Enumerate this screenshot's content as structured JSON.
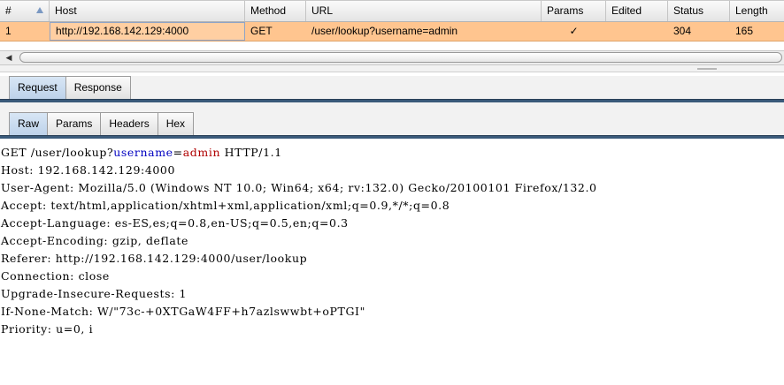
{
  "history_table": {
    "columns": [
      "#",
      "Host",
      "Method",
      "URL",
      "Params",
      "Edited",
      "Status",
      "Length"
    ],
    "rows": [
      {
        "num": "1",
        "host": "http://192.168.142.129:4000",
        "method": "GET",
        "url": "/user/lookup?username=admin",
        "params": "✓",
        "edited": "",
        "status": "304",
        "length": "165"
      }
    ],
    "row_color": "#ffc58f"
  },
  "message_tabs": [
    "Request",
    "Response"
  ],
  "request_view_tabs": [
    "Raw",
    "Params",
    "Headers",
    "Hex"
  ],
  "raw_request": {
    "request_line": {
      "prefix": "GET /user/lookup?",
      "param_name": "username",
      "equals": "=",
      "param_value": "admin",
      "suffix": " HTTP/1.1"
    },
    "headers": [
      "Host: 192.168.142.129:4000",
      "User-Agent: Mozilla/5.0 (Windows NT 10.0; Win64; x64; rv:132.0) Gecko/20100101 Firefox/132.0",
      "Accept: text/html,application/xhtml+xml,application/xml;q=0.9,*/*;q=0.8",
      "Accept-Language: es-ES,es;q=0.8,en-US;q=0.5,en;q=0.3",
      "Accept-Encoding: gzip, deflate",
      "Referer: http://192.168.142.129:4000/user/lookup",
      "Connection: close",
      "Upgrade-Insecure-Requests: 1",
      "If-None-Match: W/\"73c-+0XTGaW4FF+h7azlswwbt+oPTGI\"",
      "Priority: u=0, i"
    ],
    "param_name_color": "#0000c0",
    "param_value_color": "#b00000"
  },
  "icons": {
    "sort": "sort-ascending-icon",
    "scroll_left": "scroll-left-arrow-icon",
    "params_check": "checkmark-icon"
  }
}
